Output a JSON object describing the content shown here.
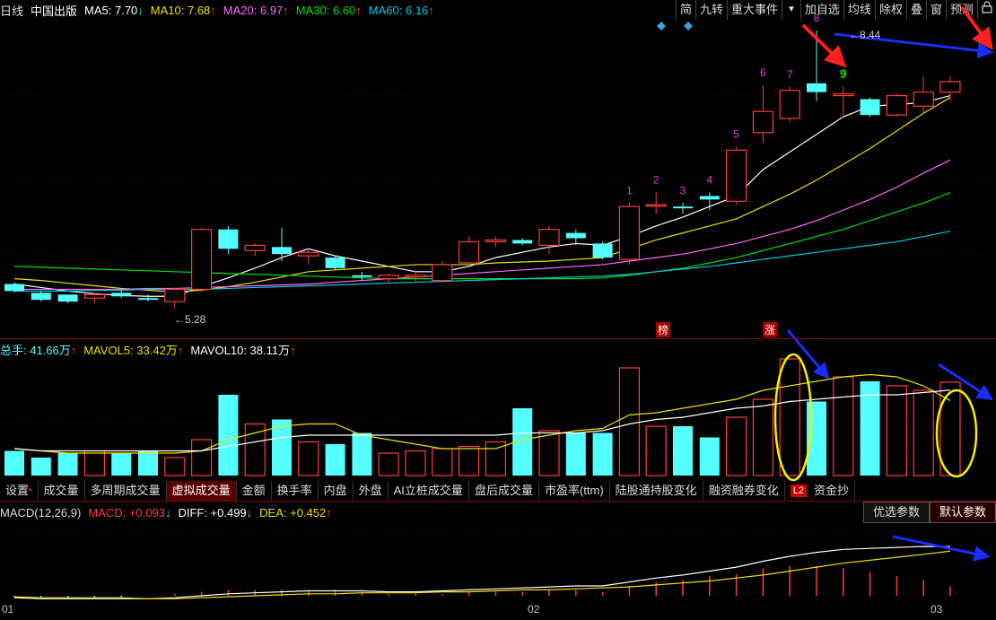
{
  "header": {
    "period": "日线",
    "stock": "中国出版",
    "ma5": {
      "label": "MA5: 7.70",
      "arrow": "↓",
      "color": "#ffffff"
    },
    "ma10": {
      "label": "MA10: 7.68",
      "arrow": "↑",
      "color": "#f0e000"
    },
    "ma20": {
      "label": "MA20: 6.97",
      "arrow": "↑",
      "color": "#ff66ff"
    },
    "ma30": {
      "label": "MA30: 6.60",
      "arrow": "↑",
      "color": "#00e000"
    },
    "ma60": {
      "label": "MA60: 6.16",
      "arrow": "↑",
      "color": "#00c8e8"
    }
  },
  "toolbar": [
    "简",
    "九转",
    "重大事件",
    "▼",
    "加自选",
    "均线",
    "除权",
    "叠",
    "窗",
    "预测"
  ],
  "lock_icon": "lock-icon",
  "price_annotations": {
    "high": "←8.44",
    "low": "←5.28"
  },
  "tags": {
    "bang": "榜",
    "zhang": "涨"
  },
  "volume_header": {
    "total": "总手: 41.66万",
    "total_arrow": "↑",
    "mavol5": "MAVOL5: 33.42万",
    "mavol5_arrow": "↑",
    "mavol10": "MAVOL10: 38.11万",
    "mavol10_arrow": "↑"
  },
  "tabs": [
    "设置",
    "成交量",
    "多周期成交量",
    "虚拟成交量",
    "金额",
    "换手率",
    "内盘",
    "外盘",
    "AI立桩成交量",
    "盘后成交量",
    "市盈率(ttm)",
    "陆股通持股变化",
    "融资融券变化",
    "L2",
    "资金抄"
  ],
  "active_tab": 3,
  "macd_header": {
    "title": "MACD(12,26,9)",
    "macd": "MACD: +0.093",
    "macd_arrow": "↓",
    "diff": "DIFF: +0.499",
    "diff_arrow": "↓",
    "dea": "DEA: +0.452",
    "dea_arrow": "↑"
  },
  "param_buttons": [
    "优选参数",
    "默认参数"
  ],
  "x_axis": {
    "labels": [
      "01",
      "02",
      "03"
    ]
  },
  "colors": {
    "up": "#ff3b3b",
    "down": "#54ffff",
    "bg": "#000000",
    "separator": "#8b0000"
  },
  "chart_data": {
    "type": "candlestick",
    "candles": [
      {
        "o": 5.56,
        "h": 5.58,
        "l": 5.46,
        "c": 5.48,
        "up": false
      },
      {
        "o": 5.46,
        "h": 5.48,
        "l": 5.36,
        "c": 5.38,
        "up": false
      },
      {
        "o": 5.36,
        "h": 5.44,
        "l": 5.34,
        "c": 5.44,
        "up": false
      },
      {
        "o": 5.4,
        "h": 5.46,
        "l": 5.34,
        "c": 5.44,
        "up": true
      },
      {
        "o": 5.46,
        "h": 5.5,
        "l": 5.4,
        "c": 5.42,
        "up": false
      },
      {
        "o": 5.4,
        "h": 5.44,
        "l": 5.36,
        "c": 5.38,
        "up": false
      },
      {
        "o": 5.36,
        "h": 5.52,
        "l": 5.28,
        "c": 5.5,
        "up": true
      },
      {
        "o": 5.5,
        "h": 6.2,
        "l": 5.48,
        "c": 6.18,
        "up": true
      },
      {
        "o": 6.18,
        "h": 6.22,
        "l": 5.9,
        "c": 5.96,
        "up": false
      },
      {
        "o": 5.94,
        "h": 6.02,
        "l": 5.88,
        "c": 6.0,
        "up": true
      },
      {
        "o": 5.98,
        "h": 6.2,
        "l": 5.82,
        "c": 5.9,
        "up": false
      },
      {
        "o": 5.88,
        "h": 5.96,
        "l": 5.78,
        "c": 5.92,
        "up": true
      },
      {
        "o": 5.86,
        "h": 5.88,
        "l": 5.72,
        "c": 5.74,
        "up": false
      },
      {
        "o": 5.66,
        "h": 5.7,
        "l": 5.6,
        "c": 5.64,
        "up": false
      },
      {
        "o": 5.62,
        "h": 5.68,
        "l": 5.56,
        "c": 5.66,
        "up": true
      },
      {
        "o": 5.64,
        "h": 5.72,
        "l": 5.58,
        "c": 5.66,
        "up": true
      },
      {
        "o": 5.6,
        "h": 5.82,
        "l": 5.58,
        "c": 5.78,
        "up": true
      },
      {
        "o": 5.8,
        "h": 6.1,
        "l": 5.78,
        "c": 6.04,
        "up": true
      },
      {
        "o": 6.04,
        "h": 6.1,
        "l": 5.98,
        "c": 6.06,
        "up": true
      },
      {
        "o": 6.02,
        "h": 6.08,
        "l": 6.0,
        "c": 6.06,
        "up": false
      },
      {
        "o": 6.18,
        "h": 6.22,
        "l": 5.9,
        "c": 6.0,
        "up": true
      },
      {
        "o": 6.14,
        "h": 6.18,
        "l": 6.0,
        "c": 6.08,
        "up": false
      },
      {
        "o": 6.02,
        "h": 6.04,
        "l": 5.84,
        "c": 5.86,
        "up": false
      },
      {
        "o": 5.84,
        "h": 6.48,
        "l": 5.78,
        "c": 6.44,
        "up": true
      },
      {
        "o": 6.46,
        "h": 6.6,
        "l": 6.36,
        "c": 6.46,
        "up": true
      },
      {
        "o": 6.44,
        "h": 6.48,
        "l": 6.36,
        "c": 6.42,
        "up": false
      },
      {
        "o": 6.52,
        "h": 6.6,
        "l": 6.4,
        "c": 6.56,
        "up": false
      },
      {
        "o": 6.5,
        "h": 7.12,
        "l": 6.46,
        "c": 7.08,
        "up": true
      },
      {
        "o": 7.28,
        "h": 7.82,
        "l": 7.16,
        "c": 7.52,
        "up": true
      },
      {
        "o": 7.44,
        "h": 7.8,
        "l": 7.4,
        "c": 7.76,
        "up": true
      },
      {
        "o": 7.84,
        "h": 8.44,
        "l": 7.64,
        "c": 7.74,
        "up": false
      },
      {
        "o": 7.72,
        "h": 7.8,
        "l": 7.46,
        "c": 7.7,
        "up": true
      },
      {
        "o": 7.66,
        "h": 7.68,
        "l": 7.46,
        "c": 7.48,
        "up": false
      },
      {
        "o": 7.48,
        "h": 7.72,
        "l": 7.46,
        "c": 7.7,
        "up": true
      },
      {
        "o": 7.58,
        "h": 7.92,
        "l": 7.5,
        "c": 7.74,
        "up": true
      },
      {
        "o": 7.74,
        "h": 7.92,
        "l": 7.64,
        "c": 7.86,
        "up": true
      }
    ],
    "nine_turn": [
      {
        "i": 23,
        "label": "1"
      },
      {
        "i": 24,
        "label": "2"
      },
      {
        "i": 25,
        "label": "3"
      },
      {
        "i": 26,
        "label": "4"
      },
      {
        "i": 27,
        "label": "5"
      },
      {
        "i": 28,
        "label": "6"
      },
      {
        "i": 29,
        "label": "7"
      },
      {
        "i": 30,
        "label": "8"
      },
      {
        "i": 31,
        "label": "9"
      }
    ],
    "ma": {
      "ma5": [
        5.56,
        5.52,
        5.48,
        5.45,
        5.43,
        5.42,
        5.42,
        5.53,
        5.63,
        5.74,
        5.86,
        5.96,
        5.88,
        5.82,
        5.76,
        5.7,
        5.7,
        5.76,
        5.86,
        5.92,
        5.98,
        6.02,
        6.0,
        6.1,
        6.22,
        6.32,
        6.44,
        6.56,
        6.86,
        7.06,
        7.26,
        7.46,
        7.58,
        7.6,
        7.62,
        7.7
      ],
      "ma10": [
        5.62,
        5.6,
        5.57,
        5.54,
        5.51,
        5.49,
        5.47,
        5.49,
        5.53,
        5.58,
        5.64,
        5.7,
        5.72,
        5.74,
        5.76,
        5.78,
        5.78,
        5.78,
        5.8,
        5.81,
        5.82,
        5.84,
        5.86,
        5.96,
        6.06,
        6.14,
        6.22,
        6.3,
        6.44,
        6.58,
        6.74,
        6.92,
        7.1,
        7.3,
        7.5,
        7.68
      ],
      "ma20": [
        5.5,
        5.5,
        5.5,
        5.5,
        5.5,
        5.51,
        5.51,
        5.52,
        5.53,
        5.54,
        5.55,
        5.56,
        5.58,
        5.6,
        5.62,
        5.64,
        5.66,
        5.68,
        5.7,
        5.72,
        5.74,
        5.76,
        5.78,
        5.82,
        5.86,
        5.9,
        5.96,
        6.02,
        6.1,
        6.18,
        6.28,
        6.4,
        6.52,
        6.66,
        6.82,
        6.97
      ],
      "ma30": [
        5.76,
        5.75,
        5.74,
        5.73,
        5.72,
        5.71,
        5.7,
        5.69,
        5.68,
        5.67,
        5.66,
        5.65,
        5.64,
        5.63,
        5.62,
        5.62,
        5.62,
        5.62,
        5.62,
        5.62,
        5.62,
        5.62,
        5.63,
        5.66,
        5.7,
        5.74,
        5.8,
        5.86,
        5.94,
        6.02,
        6.1,
        6.18,
        6.28,
        6.38,
        6.48,
        6.6
      ],
      "ma60": [
        5.48,
        5.48,
        5.48,
        5.49,
        5.49,
        5.5,
        5.5,
        5.5,
        5.51,
        5.52,
        5.53,
        5.54,
        5.55,
        5.56,
        5.57,
        5.58,
        5.59,
        5.6,
        5.61,
        5.62,
        5.63,
        5.64,
        5.65,
        5.67,
        5.7,
        5.73,
        5.76,
        5.8,
        5.84,
        5.88,
        5.92,
        5.96,
        6.0,
        6.04,
        6.1,
        6.16
      ]
    },
    "volume": [
      11,
      8,
      10,
      11,
      10,
      11,
      8,
      16,
      36,
      23,
      25,
      15,
      14,
      19,
      10,
      11,
      12,
      13,
      15,
      30,
      20,
      19,
      19,
      48,
      22,
      22,
      17,
      26,
      34,
      52,
      33,
      44,
      42,
      40,
      38,
      41.66
    ],
    "mavol5": [
      12,
      11,
      10,
      10,
      10,
      10,
      10,
      11,
      16,
      19,
      22,
      23,
      23,
      18,
      16,
      14,
      12,
      12,
      12,
      16,
      18,
      20,
      21,
      27,
      28,
      30,
      32,
      34,
      38,
      40,
      42,
      44,
      45,
      44,
      40,
      33.42
    ],
    "mavol10": [
      12,
      11,
      11,
      11,
      11,
      11,
      11,
      11,
      13,
      15,
      17,
      18,
      18,
      18,
      18,
      18,
      18,
      18,
      18,
      19,
      19,
      19,
      20,
      23,
      25,
      26,
      28,
      30,
      31,
      33,
      34,
      35,
      36,
      36,
      37,
      38.11
    ],
    "macd": {
      "diff": [
        -0.02,
        -0.03,
        -0.03,
        -0.03,
        -0.03,
        -0.03,
        -0.02,
        0.0,
        0.02,
        0.03,
        0.04,
        0.05,
        0.05,
        0.05,
        0.04,
        0.04,
        0.05,
        0.06,
        0.07,
        0.08,
        0.09,
        0.1,
        0.1,
        0.14,
        0.18,
        0.21,
        0.25,
        0.29,
        0.35,
        0.4,
        0.44,
        0.47,
        0.48,
        0.49,
        0.5,
        0.499
      ],
      "dea": [
        -0.01,
        -0.02,
        -0.02,
        -0.02,
        -0.02,
        -0.03,
        -0.03,
        -0.02,
        -0.01,
        0.0,
        0.01,
        0.02,
        0.02,
        0.03,
        0.03,
        0.03,
        0.04,
        0.04,
        0.05,
        0.06,
        0.06,
        0.07,
        0.08,
        0.09,
        0.11,
        0.13,
        0.15,
        0.18,
        0.21,
        0.25,
        0.29,
        0.33,
        0.36,
        0.39,
        0.42,
        0.452
      ]
    }
  }
}
